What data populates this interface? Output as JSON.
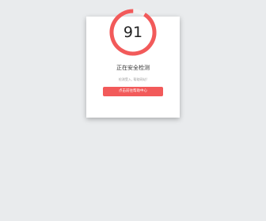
{
  "security_check": {
    "score": "91",
    "score_fraction": 0.91,
    "title": "正在安全检测",
    "subtitle": "检测受入, 帮助网站!",
    "button_label": "点击前往帮助中心",
    "colors": {
      "accent": "#f25a5a",
      "ring_track": "#f1f1f1",
      "background": "#e9ebed"
    }
  }
}
